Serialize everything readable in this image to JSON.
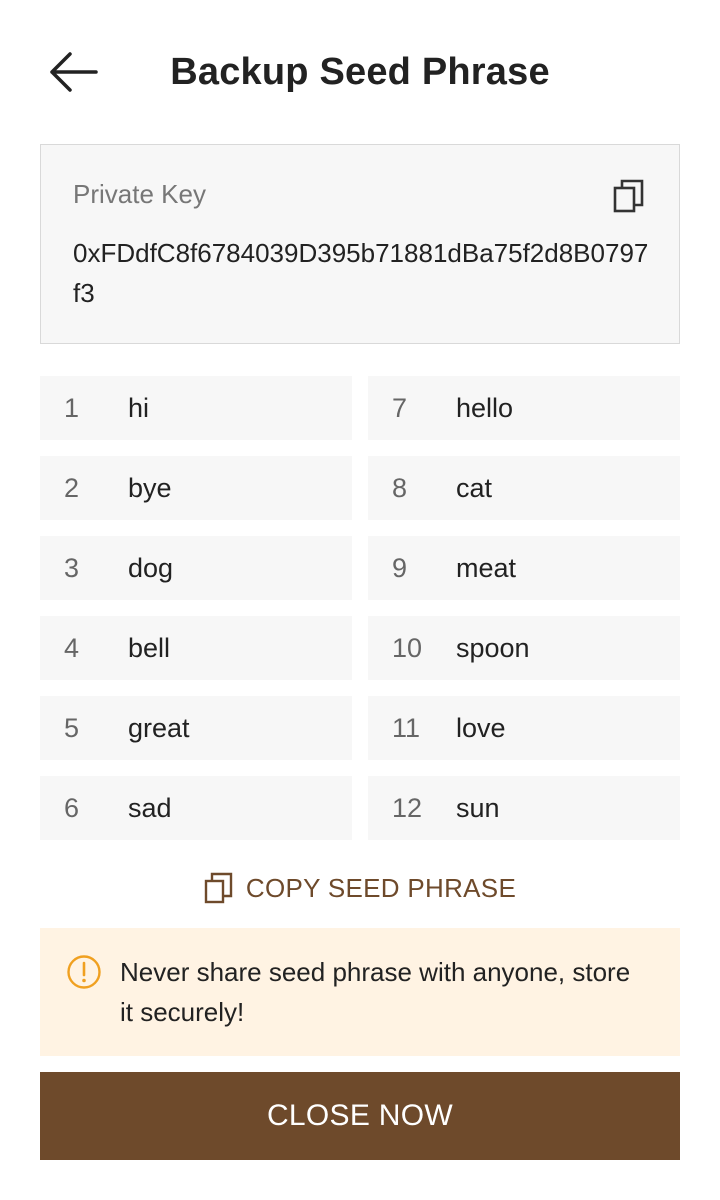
{
  "header": {
    "title": "Backup Seed Phrase",
    "back_icon": "arrow-left-icon"
  },
  "private_key": {
    "label": "Private Key",
    "value": "0xFDdfC8f6784039D395b71881dBa75f2d8B0797f3",
    "copy_icon": "copy-icon"
  },
  "seed_words": [
    {
      "num": "1",
      "word": "hi"
    },
    {
      "num": "7",
      "word": "hello"
    },
    {
      "num": "2",
      "word": "bye"
    },
    {
      "num": "8",
      "word": "cat"
    },
    {
      "num": "3",
      "word": "dog"
    },
    {
      "num": "9",
      "word": "meat"
    },
    {
      "num": "4",
      "word": "bell"
    },
    {
      "num": "10",
      "word": "spoon"
    },
    {
      "num": "5",
      "word": "great"
    },
    {
      "num": "11",
      "word": "love"
    },
    {
      "num": "6",
      "word": "sad"
    },
    {
      "num": "12",
      "word": "sun"
    }
  ],
  "copy_seed": {
    "label": "COPY SEED PHRASE",
    "icon": "copy-icon"
  },
  "warning": {
    "icon": "alert-circle-icon",
    "text": "Never share seed phrase with anyone, store it securely!"
  },
  "close_button": {
    "label": "CLOSE NOW"
  },
  "colors": {
    "accent": "#6e4a2b",
    "warning_bg": "#fff3e3",
    "warning_icon": "#f0a020",
    "card_bg": "#f7f7f7"
  }
}
